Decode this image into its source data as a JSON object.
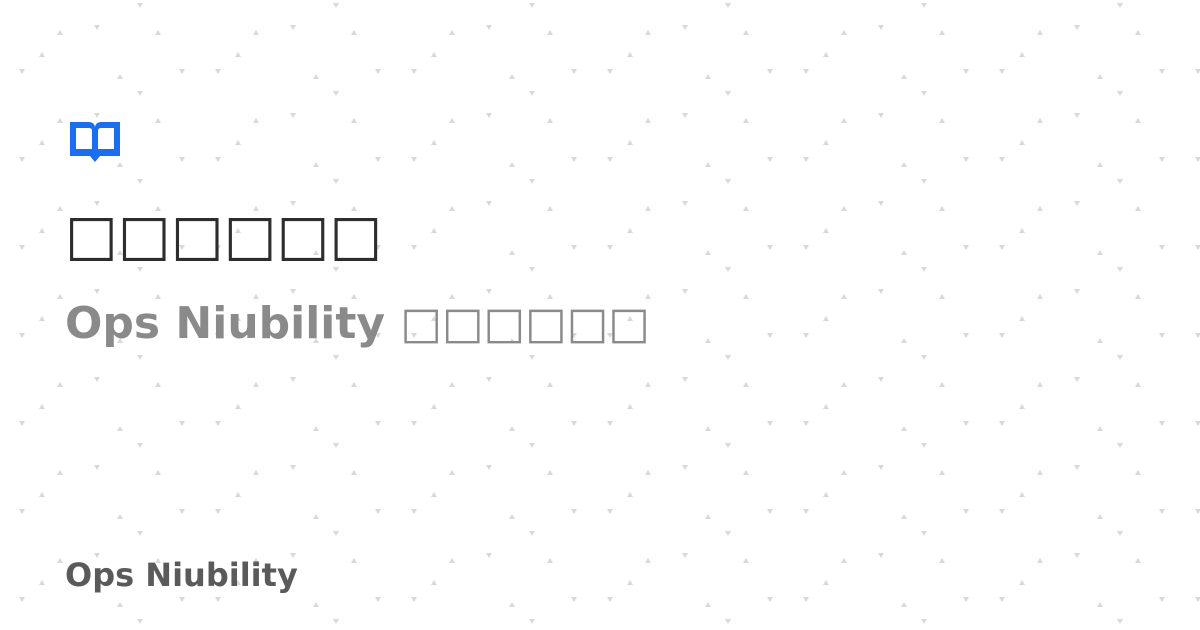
{
  "page": {
    "title": "□□□□□□",
    "subtitle": "Ops Niubility □□□□□□",
    "site_name": "Ops Niubility"
  },
  "icons": {
    "logo": "book-icon",
    "background": "dot-pattern"
  },
  "colors": {
    "logo": "#1a6ef0",
    "title": "#2d2d2d",
    "subtitle": "#8a8a8a",
    "site_name": "#5a5a5a",
    "pattern": "#d9d9d9",
    "background": "#ffffff"
  }
}
